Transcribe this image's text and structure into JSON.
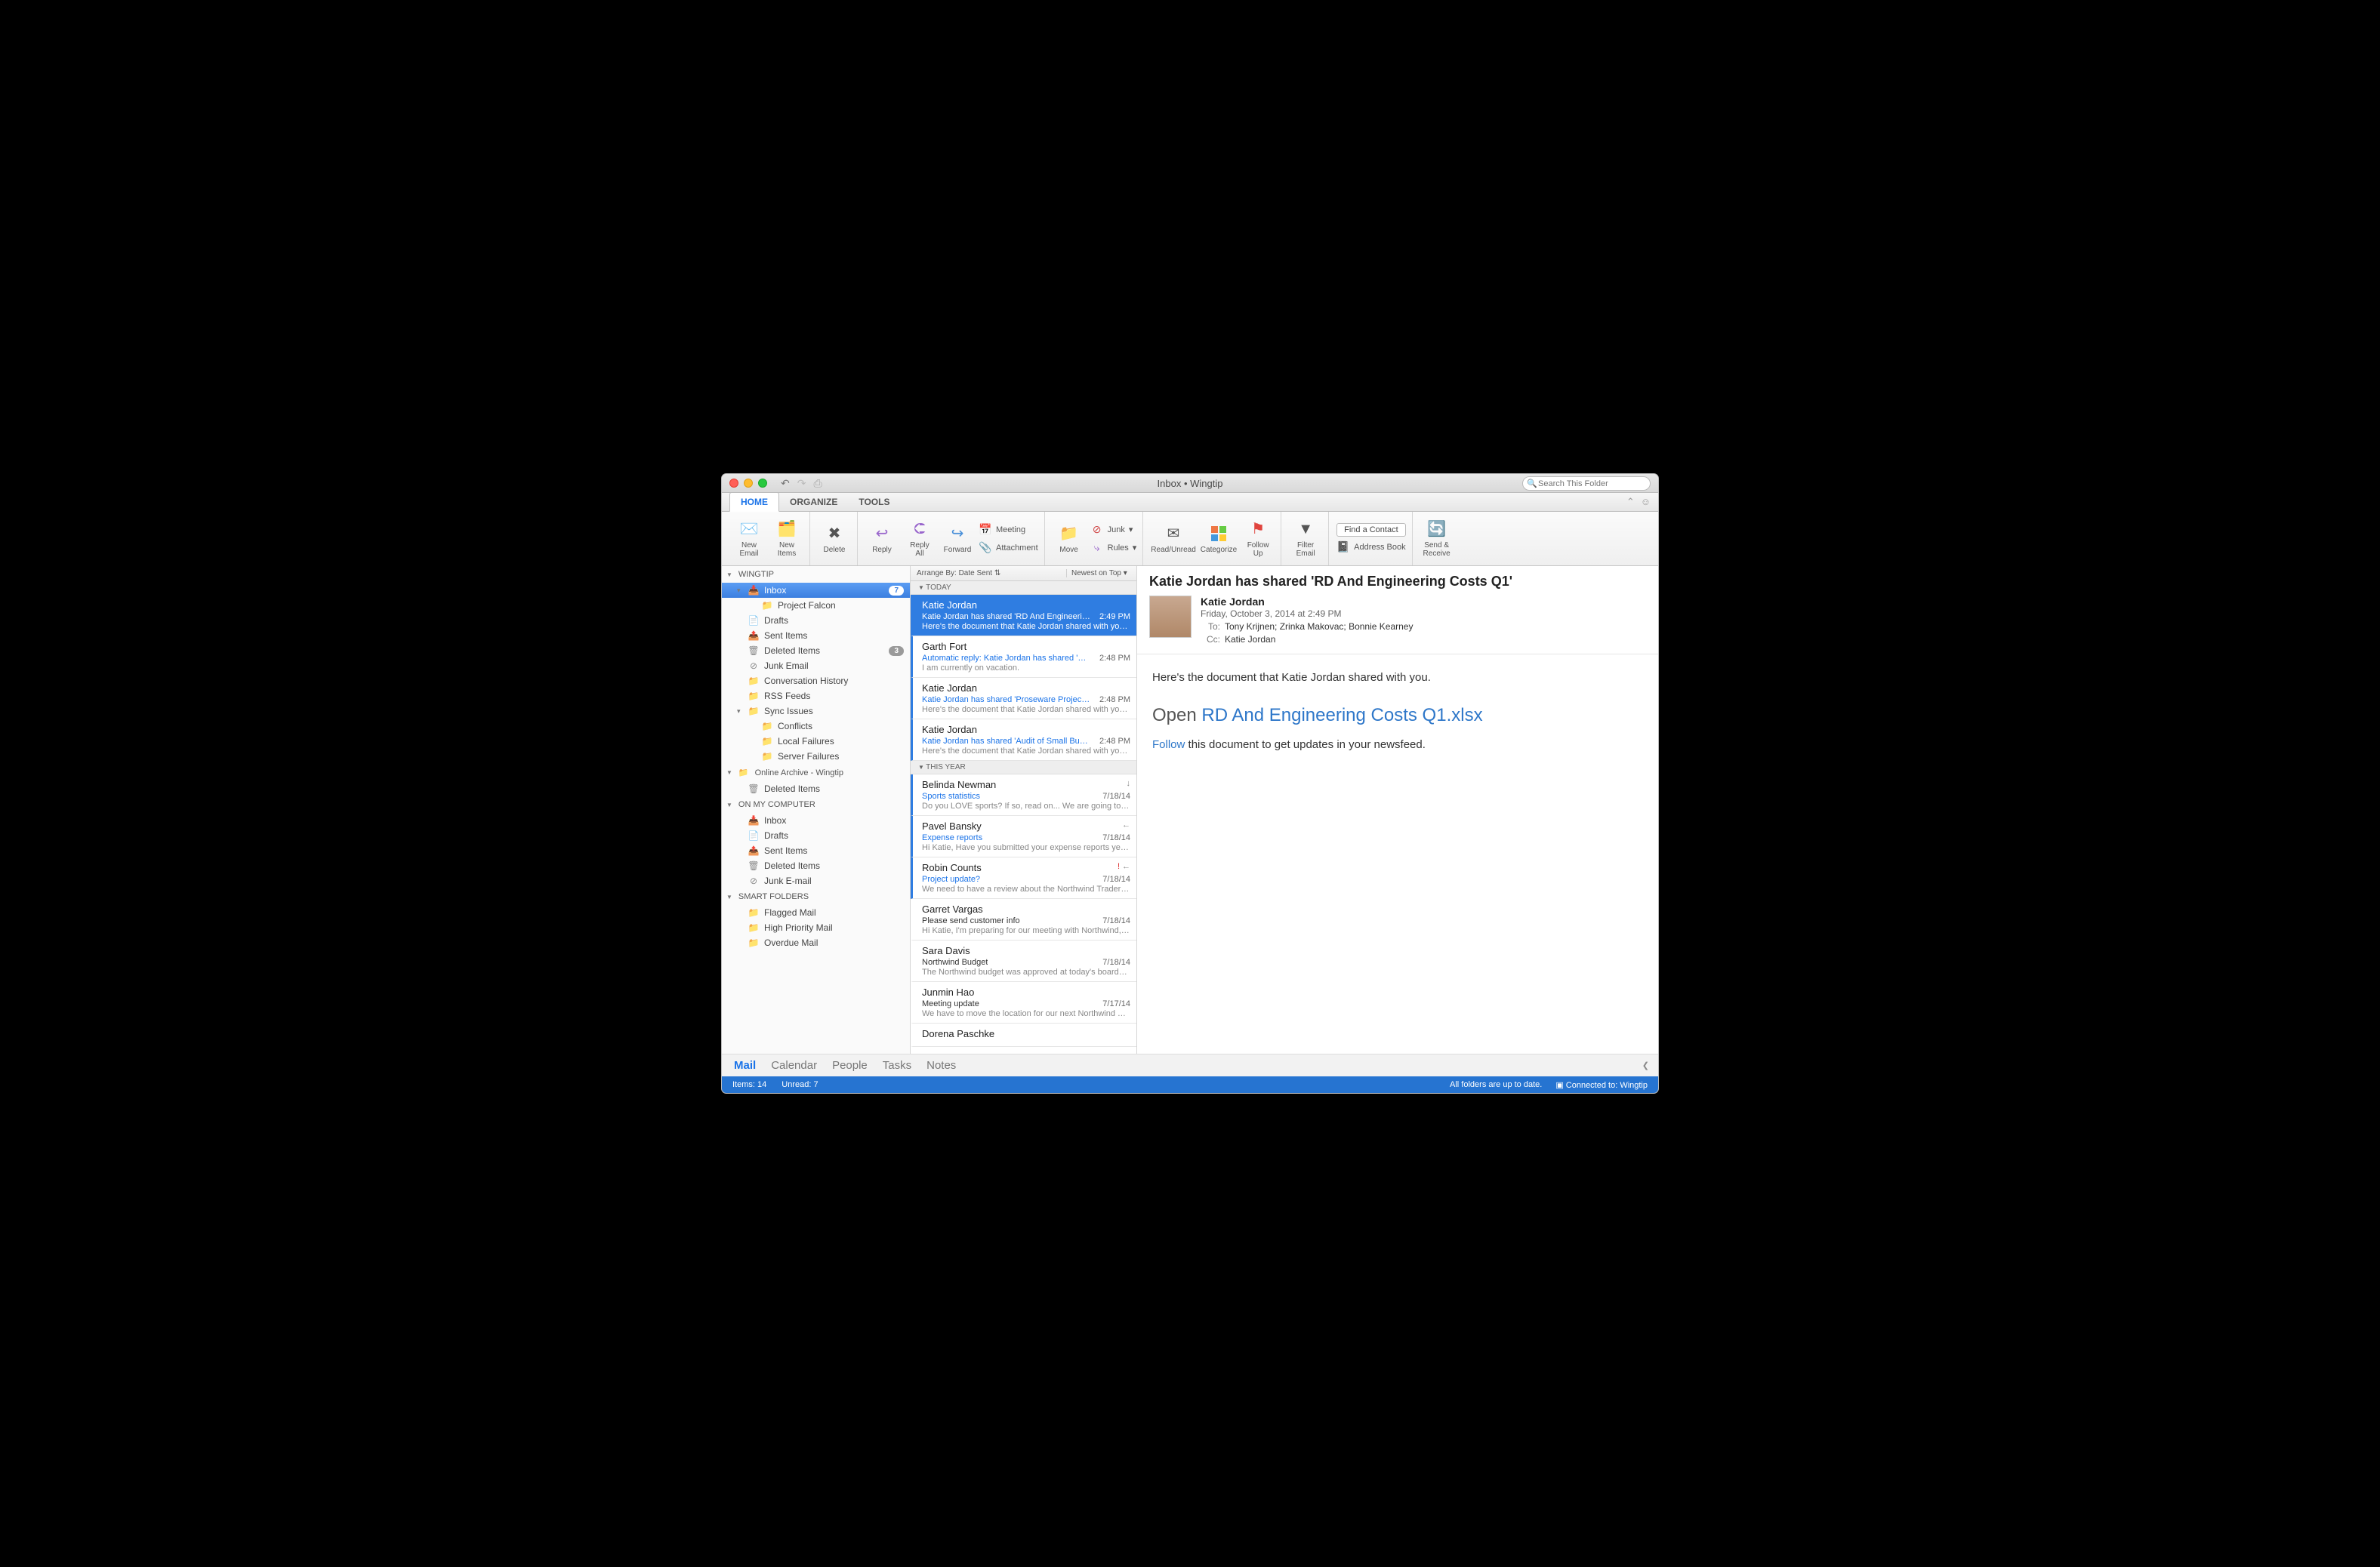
{
  "window": {
    "title": "Inbox • Wingtip",
    "search_placeholder": "Search This Folder"
  },
  "tabs": {
    "home": "HOME",
    "organize": "ORGANIZE",
    "tools": "TOOLS"
  },
  "ribbon": {
    "new_email": "New\nEmail",
    "new_items": "New\nItems",
    "delete": "Delete",
    "reply": "Reply",
    "reply_all": "Reply\nAll",
    "forward": "Forward",
    "meeting": "Meeting",
    "attachment": "Attachment",
    "move": "Move",
    "junk": "Junk",
    "rules": "Rules",
    "read_unread": "Read/Unread",
    "categorize": "Categorize",
    "follow_up": "Follow\nUp",
    "filter_email": "Filter\nEmail",
    "find_contact": "Find a Contact",
    "address_book": "Address Book",
    "send_receive": "Send &\nReceive"
  },
  "sidebar": {
    "wingtip": "WINGTIP",
    "inbox": "Inbox",
    "inbox_count": "7",
    "project_falcon": "Project Falcon",
    "drafts": "Drafts",
    "sent_items": "Sent Items",
    "deleted_items": "Deleted Items",
    "deleted_count": "3",
    "junk_email": "Junk Email",
    "conversation_history": "Conversation History",
    "rss_feeds": "RSS Feeds",
    "sync_issues": "Sync Issues",
    "conflicts": "Conflicts",
    "local_failures": "Local Failures",
    "server_failures": "Server Failures",
    "online_archive": "Online Archive - Wingtip",
    "oa_deleted": "Deleted Items",
    "on_my_computer": "ON MY COMPUTER",
    "omc_inbox": "Inbox",
    "omc_drafts": "Drafts",
    "omc_sent": "Sent Items",
    "omc_deleted": "Deleted Items",
    "omc_junk": "Junk E-mail",
    "smart_folders": "SMART FOLDERS",
    "flagged_mail": "Flagged Mail",
    "high_priority": "High Priority Mail",
    "overdue_mail": "Overdue Mail"
  },
  "list": {
    "arrange_by": "Arrange By: Date Sent  ⇅",
    "sort": "Newest on Top ▾",
    "sections": {
      "today": "TODAY",
      "this_year": "THIS YEAR"
    },
    "items": [
      {
        "sender": "Katie Jordan",
        "subject": "Katie Jordan has shared 'RD And Engineeri…",
        "preview": "Here's the document that Katie Jordan shared with you…",
        "time": "2:49 PM",
        "unread": true,
        "selected": true
      },
      {
        "sender": "Garth Fort",
        "subject": "Automatic reply: Katie Jordan has shared '…",
        "preview": "I am currently on vacation.",
        "time": "2:48 PM",
        "unread": true
      },
      {
        "sender": "Katie Jordan",
        "subject": "Katie Jordan has shared 'Proseware Projec…",
        "preview": "Here's the document that Katie Jordan shared with you…",
        "time": "2:48 PM",
        "unread": true
      },
      {
        "sender": "Katie Jordan",
        "subject": "Katie Jordan has shared 'Audit of Small Bu…",
        "preview": "Here's the document that Katie Jordan shared with you…",
        "time": "2:48 PM",
        "unread": true
      },
      {
        "sender": "Belinda Newman",
        "subject": "Sports statistics",
        "preview": "Do you LOVE sports? If so, read on... We are going to…",
        "time": "7/18/14",
        "unread": true,
        "fwd": true
      },
      {
        "sender": "Pavel Bansky",
        "subject": "Expense reports",
        "preview": "Hi Katie, Have you submitted your expense reports yet…",
        "time": "7/18/14",
        "unread": true,
        "reply": true
      },
      {
        "sender": "Robin Counts",
        "subject": "Project update?",
        "preview": "We need to have a review about the Northwind Traders…",
        "time": "7/18/14",
        "unread": true,
        "important": true,
        "reply": true
      },
      {
        "sender": "Garret Vargas",
        "subject": "Please send customer info",
        "preview": "Hi Katie, I'm preparing for our meeting with Northwind,…",
        "time": "7/18/14",
        "read": true
      },
      {
        "sender": "Sara Davis",
        "subject": "Northwind Budget",
        "preview": "The Northwind budget was approved at today's board…",
        "time": "7/18/14",
        "read": true
      },
      {
        "sender": "Junmin Hao",
        "subject": "Meeting update",
        "preview": "We have to move the location for our next Northwind Tr…",
        "time": "7/17/14",
        "read": true
      },
      {
        "sender": "Dorena Paschke",
        "subject": "",
        "preview": "",
        "time": "",
        "read": true
      }
    ]
  },
  "reading": {
    "subject": "Katie Jordan has shared 'RD And Engineering Costs Q1'",
    "from": "Katie Jordan",
    "date": "Friday, October 3, 2014 at 2:49 PM",
    "to_label": "To:",
    "cc_label": "Cc:",
    "to": "Tony Krijnen;   Zrinka Makovac;   Bonnie Kearney",
    "cc": "Katie Jordan",
    "intro": "Here's the document that Katie Jordan shared with you.",
    "open_word": "Open ",
    "doc_link": "RD And Engineering Costs Q1.xlsx",
    "follow_word": "Follow",
    "follow_rest": " this document to get updates in your newsfeed."
  },
  "navbar": {
    "mail": "Mail",
    "calendar": "Calendar",
    "people": "People",
    "tasks": "Tasks",
    "notes": "Notes"
  },
  "status": {
    "items": "Items: 14",
    "unread": "Unread: 7",
    "sync": "All folders are up to date.",
    "connected": "Connected to: Wingtip"
  }
}
